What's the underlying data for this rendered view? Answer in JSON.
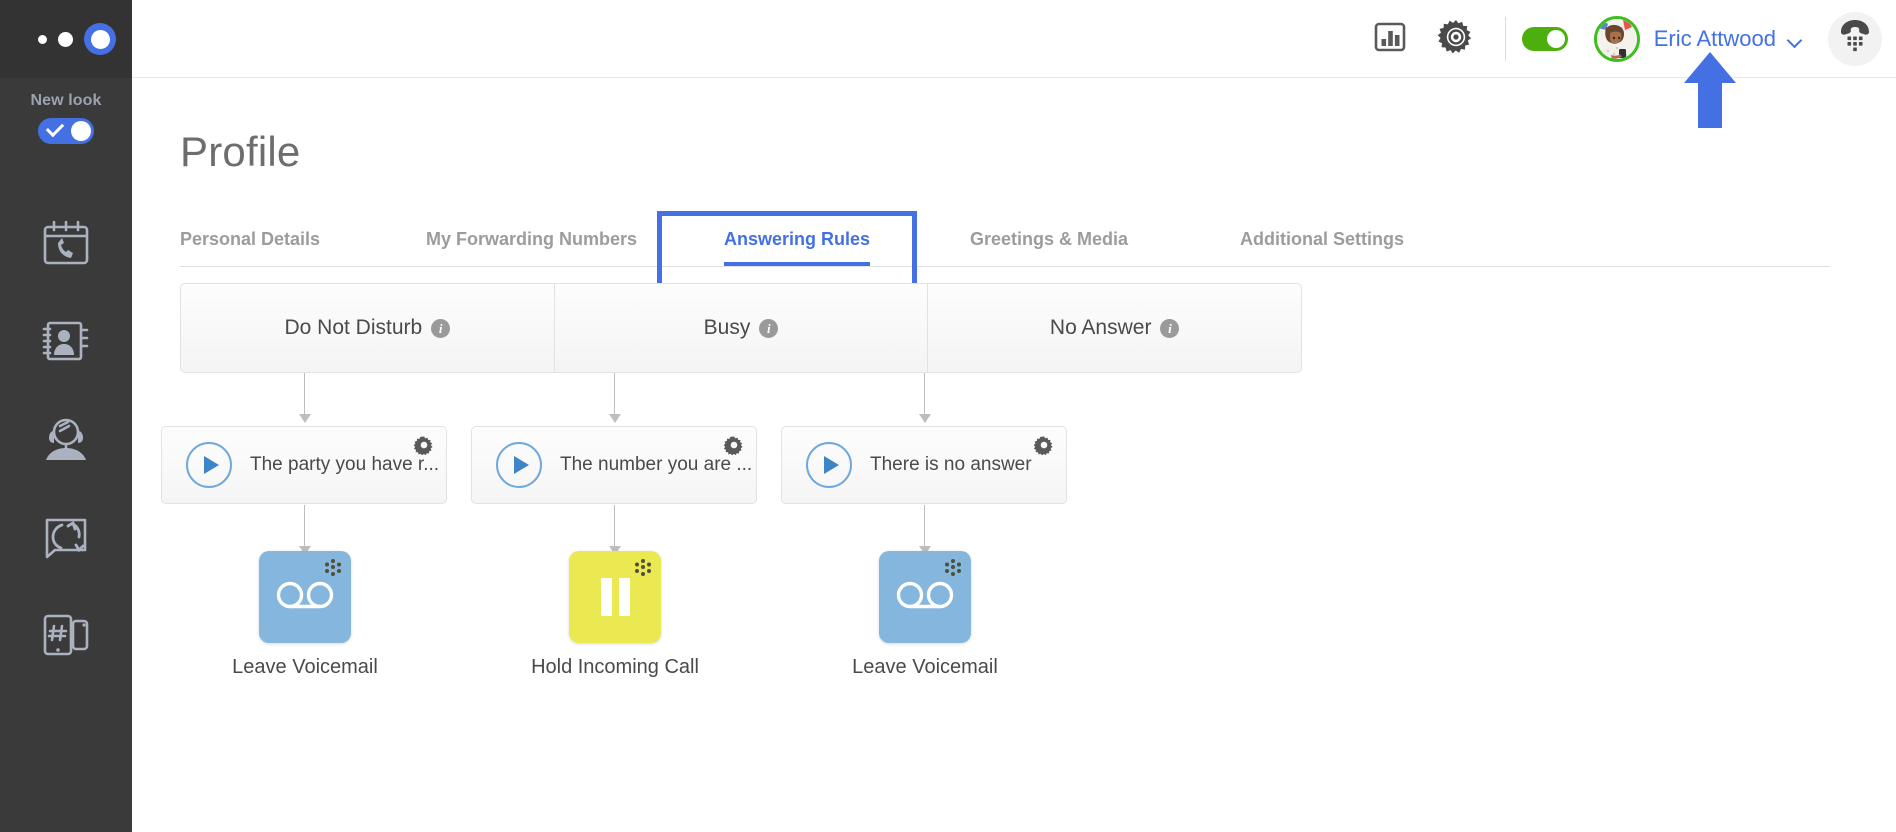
{
  "sidebar": {
    "logo_dots": [
      "dot-small",
      "dot-medium",
      "dot-ring-active"
    ],
    "new_look": {
      "label": "New look",
      "toggle_state": "on",
      "toggle_color": "#4470e3"
    },
    "items": [
      {
        "name": "call-history",
        "icon": "calendar-phone-icon"
      },
      {
        "name": "contacts",
        "icon": "address-book-icon"
      },
      {
        "name": "agent-console",
        "icon": "headset-agent-icon"
      },
      {
        "name": "call-routing",
        "icon": "call-flow-icon"
      },
      {
        "name": "devices",
        "icon": "dialpad-device-icon"
      }
    ],
    "background_color": "#3a3a3a"
  },
  "header": {
    "analytics_icon": "bar-chart-icon",
    "settings_icon": "gear-icon",
    "availability_toggle": {
      "state": "on",
      "color": "#4caf0e"
    },
    "avatar": "user-avatar",
    "user_name": "Eric Attwood",
    "chevron": "chevron-down-icon",
    "dialpad_icon": "dialpad-icon",
    "accent_color": "#4470e3"
  },
  "main": {
    "page_title": "Profile",
    "tabs": [
      {
        "label": "Personal Details",
        "active": false
      },
      {
        "label": "My Forwarding Numbers",
        "active": false
      },
      {
        "label": "Answering Rules",
        "active": true
      },
      {
        "label": "Greetings & Media",
        "active": false
      },
      {
        "label": "Additional Settings",
        "active": false
      }
    ],
    "highlight": {
      "target_tab": "Answering Rules",
      "color": "#2f5fe0"
    },
    "annotation_arrow": {
      "color": "#4470e3",
      "points_to": "Eric Attwood"
    },
    "rules": [
      {
        "condition": "Do Not Disturb",
        "info_icon": "info-icon",
        "greeting": "The party you have r...",
        "greeting_gear": "gear-icon",
        "play_icon": "play-icon",
        "action_label": "Leave Voicemail",
        "action_icon": "voicemail-icon",
        "action_color": "#85b6dd"
      },
      {
        "condition": "Busy",
        "info_icon": "info-icon",
        "greeting": "The number you are ...",
        "greeting_gear": "gear-icon",
        "play_icon": "play-icon",
        "action_label": "Hold Incoming Call",
        "action_icon": "pause-icon",
        "action_color": "#eae952"
      },
      {
        "condition": "No Answer",
        "info_icon": "info-icon",
        "greeting": "There is no answer",
        "greeting_gear": "gear-icon",
        "play_icon": "play-icon",
        "action_label": "Leave Voicemail",
        "action_icon": "voicemail-icon",
        "action_color": "#85b6dd"
      }
    ],
    "info_badge_char": "i"
  }
}
